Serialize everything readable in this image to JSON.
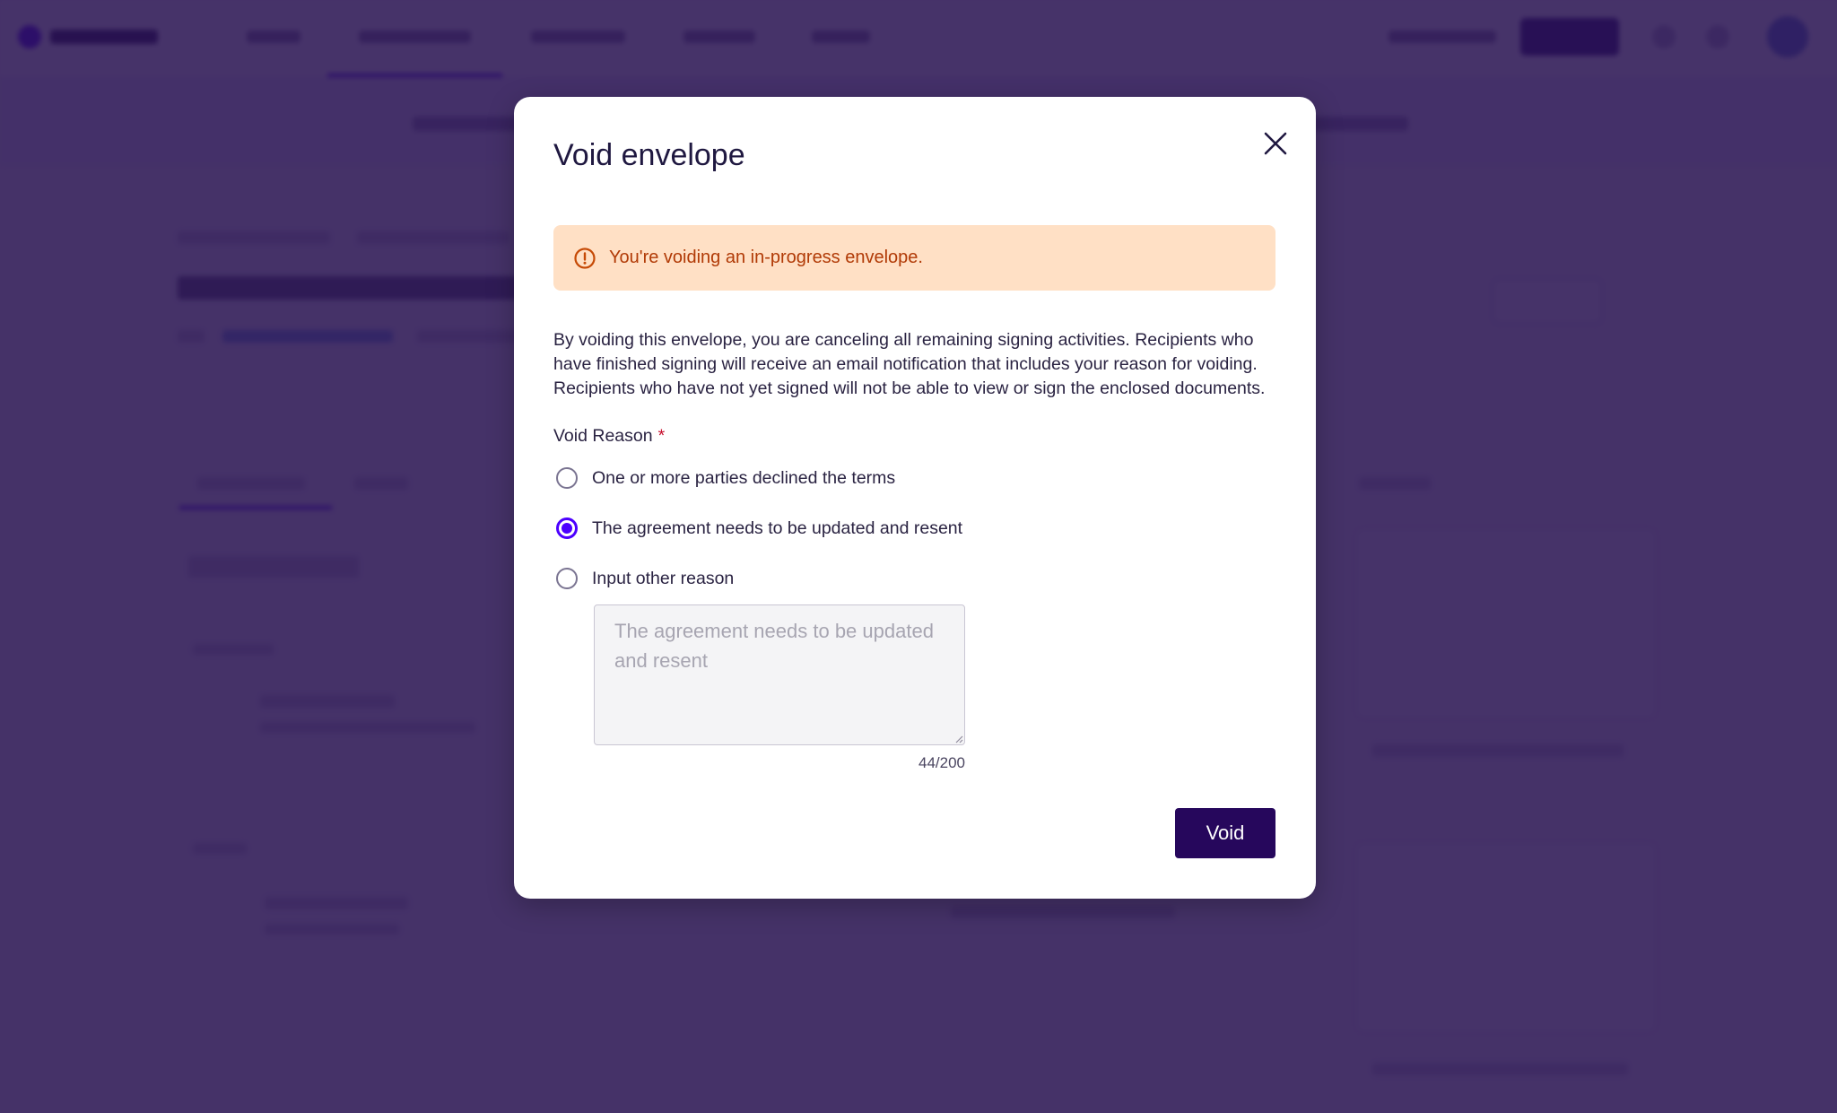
{
  "modal": {
    "title": "Void envelope",
    "close_icon": "close-icon",
    "alert": {
      "icon": "warning-circle-icon",
      "text": "You're voiding an in-progress envelope.",
      "background": "#ffe0c5",
      "text_color": "#b13a06"
    },
    "description": "By voiding this envelope, you are canceling all remaining signing activities. Recipients who have finished signing will receive an email notification that includes your reason for voiding. Recipients who have not yet signed will not be able to view or sign the enclosed documents.",
    "void_reason": {
      "label": "Void Reason",
      "required_marker": "*",
      "options": [
        {
          "label": "One or more parties declined the terms",
          "checked": false
        },
        {
          "label": "The agreement needs to be updated and resent",
          "checked": true
        },
        {
          "label": "Input other reason",
          "checked": false
        }
      ],
      "other_reason_value": "",
      "other_reason_placeholder": "The agreement needs to be updated and resent",
      "char_counter": "44/200"
    },
    "void_button_label": "Void"
  },
  "colors": {
    "accent": "#4c00ff",
    "primary_button": "#26075c",
    "overlay": "#281250"
  }
}
